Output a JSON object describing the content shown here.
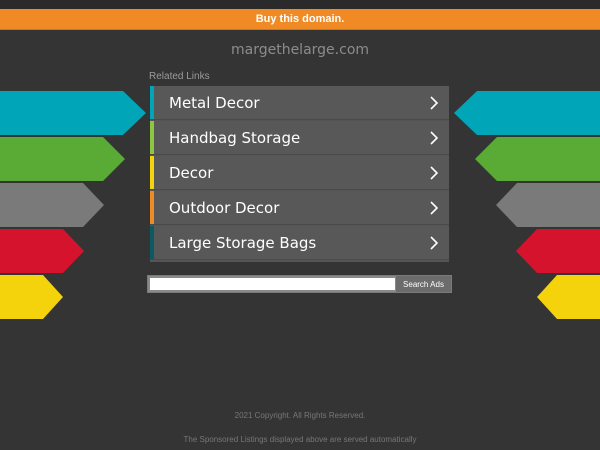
{
  "header": {
    "buy_label": "Buy this domain."
  },
  "domain": "margethelarge.com",
  "related": {
    "title": "Related Links",
    "links": [
      {
        "label": "Metal Decor",
        "accent": "#00a6b7"
      },
      {
        "label": "Handbag Storage",
        "accent": "#8dc63f"
      },
      {
        "label": "Decor",
        "accent": "#f4d20c"
      },
      {
        "label": "Outdoor Decor",
        "accent": "#f08a24"
      },
      {
        "label": "Large Storage Bags",
        "accent": "#0b5a63"
      }
    ]
  },
  "search": {
    "button_label": "Search Ads",
    "value": ""
  },
  "footer": {
    "copyright": "2021 Copyright. All Rights Reserved.",
    "sponsored": "The Sponsored Listings displayed above are served automatically"
  },
  "decoration": {
    "arrow_colors": [
      "#00a6b7",
      "#5aab35",
      "#7a7a7a",
      "#d6132c",
      "#f4d20c"
    ]
  }
}
